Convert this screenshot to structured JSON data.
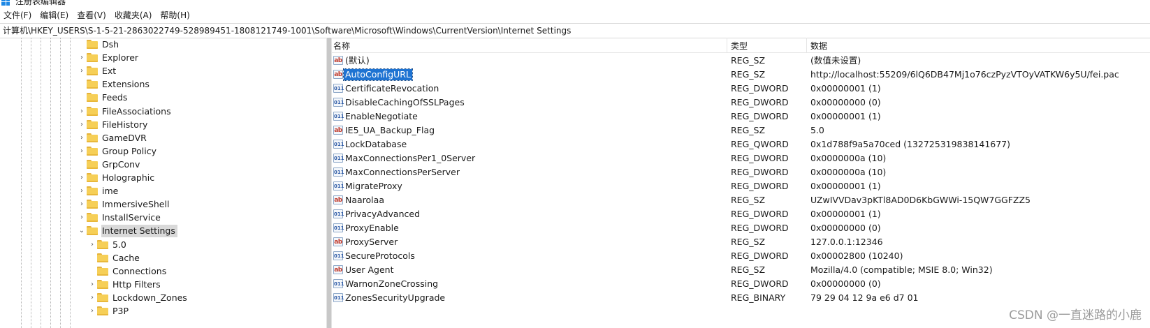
{
  "window": {
    "title": "注册表编辑器"
  },
  "menu": [
    {
      "label": "文件(F)",
      "name": "menu-file"
    },
    {
      "label": "编辑(E)",
      "name": "menu-edit"
    },
    {
      "label": "查看(V)",
      "name": "menu-view"
    },
    {
      "label": "收藏夹(A)",
      "name": "menu-favorites"
    },
    {
      "label": "帮助(H)",
      "name": "menu-help"
    }
  ],
  "address": {
    "value": "计算机\\HKEY_USERS\\S-1-5-21-2863022749-528989451-1808121749-1001\\Software\\Microsoft\\Windows\\CurrentVersion\\Internet Settings"
  },
  "tree": [
    {
      "label": "Dsh",
      "depth": 0,
      "expand": ""
    },
    {
      "label": "Explorer",
      "depth": 0,
      "expand": "›"
    },
    {
      "label": "Ext",
      "depth": 0,
      "expand": "›"
    },
    {
      "label": "Extensions",
      "depth": 0,
      "expand": ""
    },
    {
      "label": "Feeds",
      "depth": 0,
      "expand": ""
    },
    {
      "label": "FileAssociations",
      "depth": 0,
      "expand": "›"
    },
    {
      "label": "FileHistory",
      "depth": 0,
      "expand": "›"
    },
    {
      "label": "GameDVR",
      "depth": 0,
      "expand": "›"
    },
    {
      "label": "Group Policy",
      "depth": 0,
      "expand": "›"
    },
    {
      "label": "GrpConv",
      "depth": 0,
      "expand": ""
    },
    {
      "label": "Holographic",
      "depth": 0,
      "expand": "›"
    },
    {
      "label": "ime",
      "depth": 0,
      "expand": "›"
    },
    {
      "label": "ImmersiveShell",
      "depth": 0,
      "expand": "›"
    },
    {
      "label": "InstallService",
      "depth": 0,
      "expand": "›"
    },
    {
      "label": "Internet Settings",
      "depth": 0,
      "expand": "⌄",
      "selected": true
    },
    {
      "label": "5.0",
      "depth": 1,
      "expand": "›"
    },
    {
      "label": "Cache",
      "depth": 1,
      "expand": ""
    },
    {
      "label": "Connections",
      "depth": 1,
      "expand": ""
    },
    {
      "label": "Http Filters",
      "depth": 1,
      "expand": "›"
    },
    {
      "label": "Lockdown_Zones",
      "depth": 1,
      "expand": "›"
    },
    {
      "label": "P3P",
      "depth": 1,
      "expand": "›"
    }
  ],
  "columns": {
    "name": "名称",
    "type": "类型",
    "data": "数据"
  },
  "values": [
    {
      "name": "(默认)",
      "type": "REG_SZ",
      "data": "(数值未设置)",
      "icon": "ab"
    },
    {
      "name": "AutoConfigURL",
      "type": "REG_SZ",
      "data": "http://localhost:55209/6lQ6DB47Mj1o76czPyzVTOyVATKW6y5U/fei.pac",
      "icon": "ab",
      "selected": true
    },
    {
      "name": "CertificateRevocation",
      "type": "REG_DWORD",
      "data": "0x00000001 (1)",
      "icon": "num"
    },
    {
      "name": "DisableCachingOfSSLPages",
      "type": "REG_DWORD",
      "data": "0x00000000 (0)",
      "icon": "num"
    },
    {
      "name": "EnableNegotiate",
      "type": "REG_DWORD",
      "data": "0x00000001 (1)",
      "icon": "num"
    },
    {
      "name": "IE5_UA_Backup_Flag",
      "type": "REG_SZ",
      "data": "5.0",
      "icon": "ab"
    },
    {
      "name": "LockDatabase",
      "type": "REG_QWORD",
      "data": "0x1d788f9a5a70ced (132725319838141677)",
      "icon": "num"
    },
    {
      "name": "MaxConnectionsPer1_0Server",
      "type": "REG_DWORD",
      "data": "0x0000000a (10)",
      "icon": "num"
    },
    {
      "name": "MaxConnectionsPerServer",
      "type": "REG_DWORD",
      "data": "0x0000000a (10)",
      "icon": "num"
    },
    {
      "name": "MigrateProxy",
      "type": "REG_DWORD",
      "data": "0x00000001 (1)",
      "icon": "num"
    },
    {
      "name": "Naarolaa",
      "type": "REG_SZ",
      "data": "UZwIVVDav3pKTl8AD0D6KbGWWi-15QW7GGFZZ5",
      "icon": "ab"
    },
    {
      "name": "PrivacyAdvanced",
      "type": "REG_DWORD",
      "data": "0x00000001 (1)",
      "icon": "num"
    },
    {
      "name": "ProxyEnable",
      "type": "REG_DWORD",
      "data": "0x00000000 (0)",
      "icon": "num"
    },
    {
      "name": "ProxyServer",
      "type": "REG_SZ",
      "data": "127.0.0.1:12346",
      "icon": "ab"
    },
    {
      "name": "SecureProtocols",
      "type": "REG_DWORD",
      "data": "0x00002800 (10240)",
      "icon": "num"
    },
    {
      "name": "User Agent",
      "type": "REG_SZ",
      "data": "Mozilla/4.0 (compatible; MSIE 8.0; Win32)",
      "icon": "ab"
    },
    {
      "name": "WarnonZoneCrossing",
      "type": "REG_DWORD",
      "data": "0x00000000 (0)",
      "icon": "num"
    },
    {
      "name": "ZonesSecurityUpgrade",
      "type": "REG_BINARY",
      "data": "79 29 04 12 9a e6 d7 01",
      "icon": "num"
    }
  ],
  "icon_glyphs": {
    "ab": "ab",
    "num": "011"
  },
  "watermark": "CSDN @一直迷路的小鹿",
  "colors": {
    "selection": "#1e73d2",
    "tree_selection": "#d9d9d9",
    "folder": "#f6cf57",
    "string_icon": "#c0392b",
    "binary_icon": "#2d5aa6"
  }
}
